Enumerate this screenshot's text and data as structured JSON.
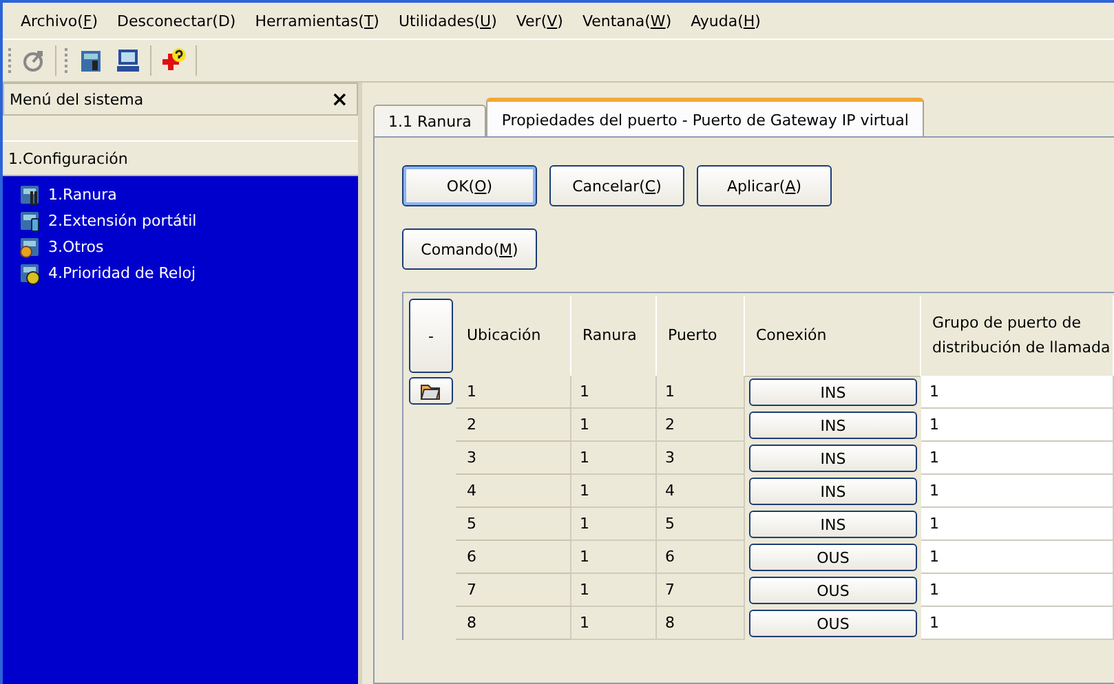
{
  "menu": [
    {
      "label": "Archivo(",
      "mnemonic": "F",
      "suffix": ")"
    },
    {
      "label": "Desconectar(D)"
    },
    {
      "label": "Herramientas(",
      "mnemonic": "T",
      "suffix": ")"
    },
    {
      "label": "Utilidades(",
      "mnemonic": "U",
      "suffix": ")"
    },
    {
      "label": "Ver(",
      "mnemonic": "V",
      "suffix": ")"
    },
    {
      "label": "Ventana(",
      "mnemonic": "W",
      "suffix": ")"
    },
    {
      "label": "Ayuda(",
      "mnemonic": "H",
      "suffix": ")"
    }
  ],
  "sidebar": {
    "title": "Menú del sistema",
    "close": "×",
    "section": "1.Configuración",
    "items": [
      {
        "label": "1.Ranura",
        "kind": "slot"
      },
      {
        "label": "2.Extensión portátil",
        "kind": "portable"
      },
      {
        "label": "3.Otros",
        "kind": "others"
      },
      {
        "label": "4.Prioridad de Reloj",
        "kind": "clock"
      }
    ]
  },
  "tabs": [
    {
      "label": "1.1 Ranura",
      "selected": false
    },
    {
      "label": "Propiedades del puerto - Puerto de Gateway IP virtual",
      "selected": true
    }
  ],
  "buttons": [
    {
      "label": "OK(",
      "mnemonic": "O",
      "suffix": ")",
      "default": true
    },
    {
      "label": "Cancelar(",
      "mnemonic": "C",
      "suffix": ")",
      "default": false
    },
    {
      "label": "Aplicar(",
      "mnemonic": "A",
      "suffix": ")",
      "default": false
    }
  ],
  "command_button": {
    "label": "Comando(",
    "mnemonic": "M",
    "suffix": ")"
  },
  "table": {
    "selector_header": "-",
    "columns": [
      "Ubicación",
      "Ranura",
      "Puerto",
      "Conexión",
      "Grupo de puerto de distribución de llamada"
    ],
    "rows": [
      {
        "cells": [
          "1",
          "1",
          "1",
          "INS",
          "1"
        ],
        "current": true
      },
      {
        "cells": [
          "2",
          "1",
          "2",
          "INS",
          "1"
        ],
        "current": false
      },
      {
        "cells": [
          "3",
          "1",
          "3",
          "INS",
          "1"
        ],
        "current": false
      },
      {
        "cells": [
          "4",
          "1",
          "4",
          "INS",
          "1"
        ],
        "current": false
      },
      {
        "cells": [
          "5",
          "1",
          "5",
          "INS",
          "1"
        ],
        "current": false
      },
      {
        "cells": [
          "6",
          "1",
          "6",
          "OUS",
          "1"
        ],
        "current": false
      },
      {
        "cells": [
          "7",
          "1",
          "7",
          "OUS",
          "1"
        ],
        "current": false
      },
      {
        "cells": [
          "8",
          "1",
          "8",
          "OUS",
          "1"
        ],
        "current": false
      }
    ]
  }
}
